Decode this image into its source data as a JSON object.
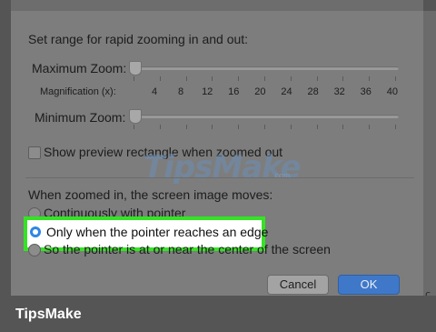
{
  "dialog": {
    "zoom_range_heading": "Set range for rapid zooming in and out:",
    "maximum_zoom_label": "Maximum Zoom:",
    "minimum_zoom_label": "Minimum Zoom:",
    "magnification_label": "Magnification (x):",
    "magnification_values": [
      "4",
      "8",
      "12",
      "16",
      "20",
      "24",
      "28",
      "32",
      "36",
      "40"
    ],
    "maximum_zoom_level": 0,
    "minimum_zoom_level": 0,
    "preview_checkbox_label": "Show preview rectangle when zoomed out",
    "preview_checked": false,
    "moves_heading": "When zoomed in, the screen image moves:",
    "options": [
      {
        "label": "Continuously with pointer",
        "selected": false
      },
      {
        "label": "Only when the pointer reaches an edge",
        "selected": true
      },
      {
        "label": "So the pointer is at or near the center of the screen",
        "selected": false
      }
    ],
    "cancel_label": "Cancel",
    "ok_label": "OK",
    "edge_glyph": "c"
  },
  "watermark": {
    "text": "TipsMake",
    "suffix": ".com"
  },
  "footer": {
    "brand": "TipsMake"
  },
  "colors": {
    "highlight": "#35e324",
    "accent": "#2f86e6",
    "ok_button": "#3f78c8"
  }
}
